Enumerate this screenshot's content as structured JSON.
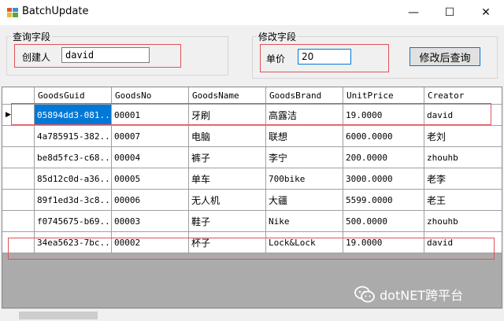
{
  "window": {
    "title": "BatchUpdate",
    "controls": {
      "minimize": "—",
      "maximize": "☐",
      "close": "✕"
    }
  },
  "query_group": {
    "caption": "查询字段",
    "creator_label": "创建人",
    "creator_value": "david"
  },
  "modify_group": {
    "caption": "修改字段",
    "price_label": "单价",
    "price_value": "20"
  },
  "query_button_label": "修改后查询",
  "grid": {
    "columns": [
      "GoodsGuid",
      "GoodsNo",
      "GoodsName",
      "GoodsBrand",
      "UnitPrice",
      "Creator"
    ],
    "rows": [
      [
        "05894dd3-081...",
        "00001",
        "牙刷",
        "高露洁",
        "19.0000",
        "david"
      ],
      [
        "4a785915-382...",
        "00007",
        "电脑",
        "联想",
        "6000.0000",
        "老刘"
      ],
      [
        "be8d5fc3-c68...",
        "00004",
        "裤子",
        "李宁",
        "200.0000",
        "zhouhb"
      ],
      [
        "85d12c0d-a36...",
        "00005",
        "单车",
        "700bike",
        "3000.0000",
        "老李"
      ],
      [
        "89f1ed3d-3c8...",
        "00006",
        "无人机",
        "大疆",
        "5599.0000",
        "老王"
      ],
      [
        "f0745675-b69...",
        "00003",
        "鞋子",
        "Nike",
        "500.0000",
        "zhouhb"
      ],
      [
        "34ea5623-7bc...",
        "00002",
        "杯子",
        "Lock&Lock",
        "19.0000",
        "david"
      ]
    ],
    "current_row_marker": "▶"
  },
  "watermark": "dotNET跨平台",
  "colors": {
    "accent": "#0078d7",
    "highlight_border": "#e0525a",
    "grid_background": "#ababab"
  }
}
